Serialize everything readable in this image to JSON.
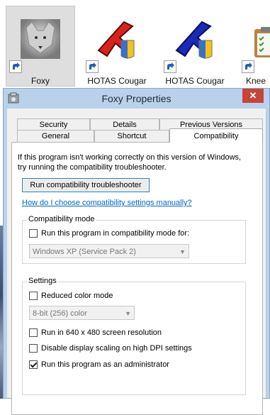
{
  "explorer": {
    "items": [
      {
        "label": "Foxy",
        "selected": true,
        "icon": "fox-icon"
      },
      {
        "label": "HOTAS Cougar",
        "selected": false,
        "icon": "red-jet-icon"
      },
      {
        "label": "HOTAS Cougar",
        "selected": false,
        "icon": "blue-jet-icon"
      },
      {
        "label": "Knee",
        "selected": false,
        "icon": "clipboard-icon"
      }
    ]
  },
  "window": {
    "title": "Foxy Properties",
    "close_label": "✕",
    "tabs_row1": [
      "Security",
      "Details",
      "Previous Versions"
    ],
    "tabs_row2": [
      "General",
      "Shortcut",
      "Compatibility"
    ],
    "active_tab": "Compatibility"
  },
  "compat": {
    "intro": "If this program isn't working correctly on this version of Windows, try running the compatibility troubleshooter.",
    "troubleshoot_button": "Run compatibility troubleshooter",
    "help_link": "How do I choose compatibility settings manually?",
    "mode_group": "Compatibility mode",
    "mode_checkbox": "Run this program in compatibility mode for:",
    "mode_checked": false,
    "mode_select": "Windows XP (Service Pack 2)",
    "settings_group": "Settings",
    "reduced_color": "Reduced color mode",
    "reduced_color_checked": false,
    "color_select": "8-bit (256) color",
    "res_640": "Run in 640 x 480 screen resolution",
    "res_640_checked": false,
    "dpi_scaling": "Disable display scaling on high DPI settings",
    "dpi_scaling_checked": false,
    "run_admin": "Run this program as an administrator",
    "run_admin_checked": true
  },
  "colors": {
    "title_bar": "#b9d1ea",
    "close_button": "#c7443a",
    "link": "#0066cc"
  }
}
